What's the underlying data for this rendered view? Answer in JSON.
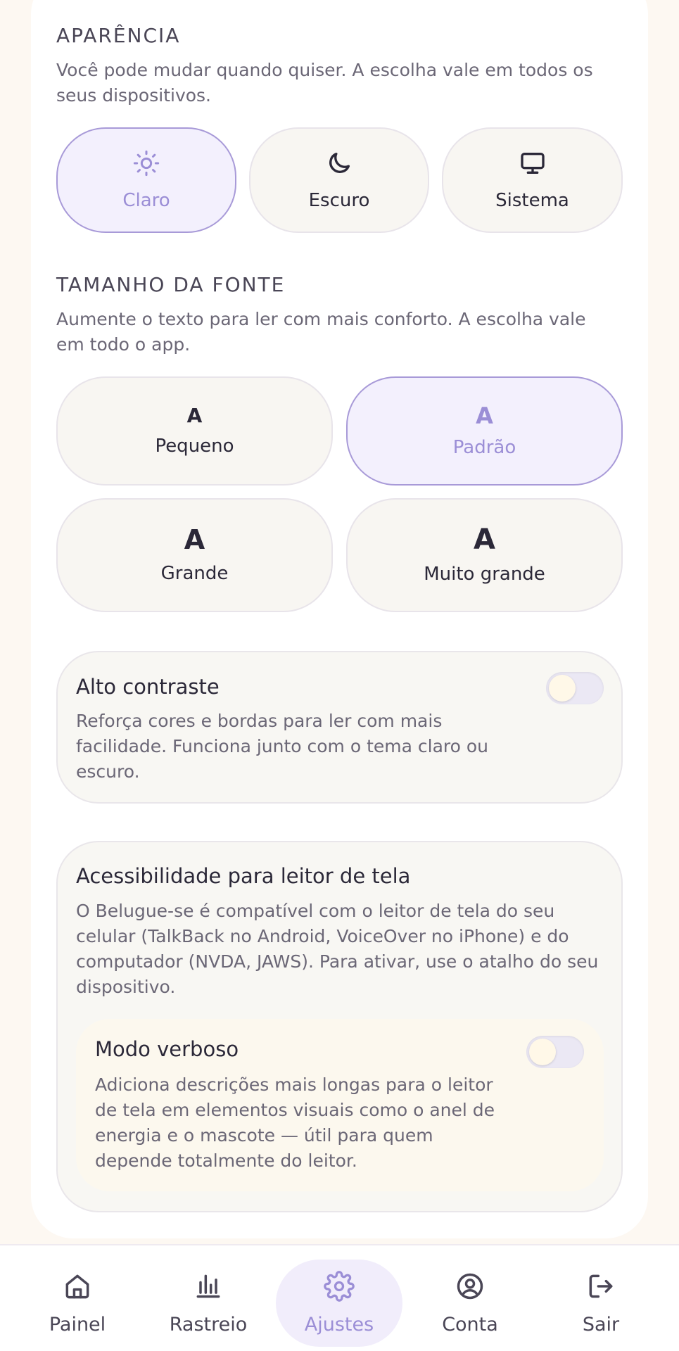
{
  "appearance": {
    "title": "APARÊNCIA",
    "description": "Você pode mudar quando quiser. A escolha vale em todos os seus dispositivos.",
    "options": [
      {
        "label": "Claro",
        "icon": "sun-icon",
        "selected": true
      },
      {
        "label": "Escuro",
        "icon": "moon-icon",
        "selected": false
      },
      {
        "label": "Sistema",
        "icon": "monitor-icon",
        "selected": false
      }
    ]
  },
  "font_size": {
    "title": "TAMANHO DA FONTE",
    "description": "Aumente o texto para ler com mais conforto. A escolha vale em todo o app.",
    "glyph": "A",
    "options": [
      {
        "label": "Pequeno",
        "selected": false
      },
      {
        "label": "Padrão",
        "selected": true
      },
      {
        "label": "Grande",
        "selected": false
      },
      {
        "label": "Muito grande",
        "selected": false
      }
    ]
  },
  "high_contrast": {
    "title": "Alto contraste",
    "description": "Reforça cores e bordas para ler com mais facilidade. Funciona junto com o tema claro ou escuro.",
    "enabled": false
  },
  "screen_reader": {
    "title": "Acessibilidade para leitor de tela",
    "description": "O Belugue-se é compatível com o leitor de tela do seu celular (TalkBack no Android, VoiceOver no iPhone) e do computador (NVDA, JAWS). Para ativar, use o atalho do seu dispositivo.",
    "verbose": {
      "title": "Modo verboso",
      "description": "Adiciona descrições mais longas para o leitor de tela em elementos visuais como o anel de energia e o mascote — útil para quem depende totalmente do leitor.",
      "enabled": false
    }
  },
  "nav": {
    "items": [
      {
        "label": "Painel",
        "icon": "home-icon",
        "active": false
      },
      {
        "label": "Rastreio",
        "icon": "bar-chart-icon",
        "active": false
      },
      {
        "label": "Ajustes",
        "icon": "gear-icon",
        "active": true
      },
      {
        "label": "Conta",
        "icon": "user-circle-icon",
        "active": false
      },
      {
        "label": "Sair",
        "icon": "logout-icon",
        "active": false
      }
    ]
  },
  "colors": {
    "accent": "#9b8ed6",
    "selected_bg": "#f3f0fd",
    "page_bg": "#fdf8f2"
  }
}
